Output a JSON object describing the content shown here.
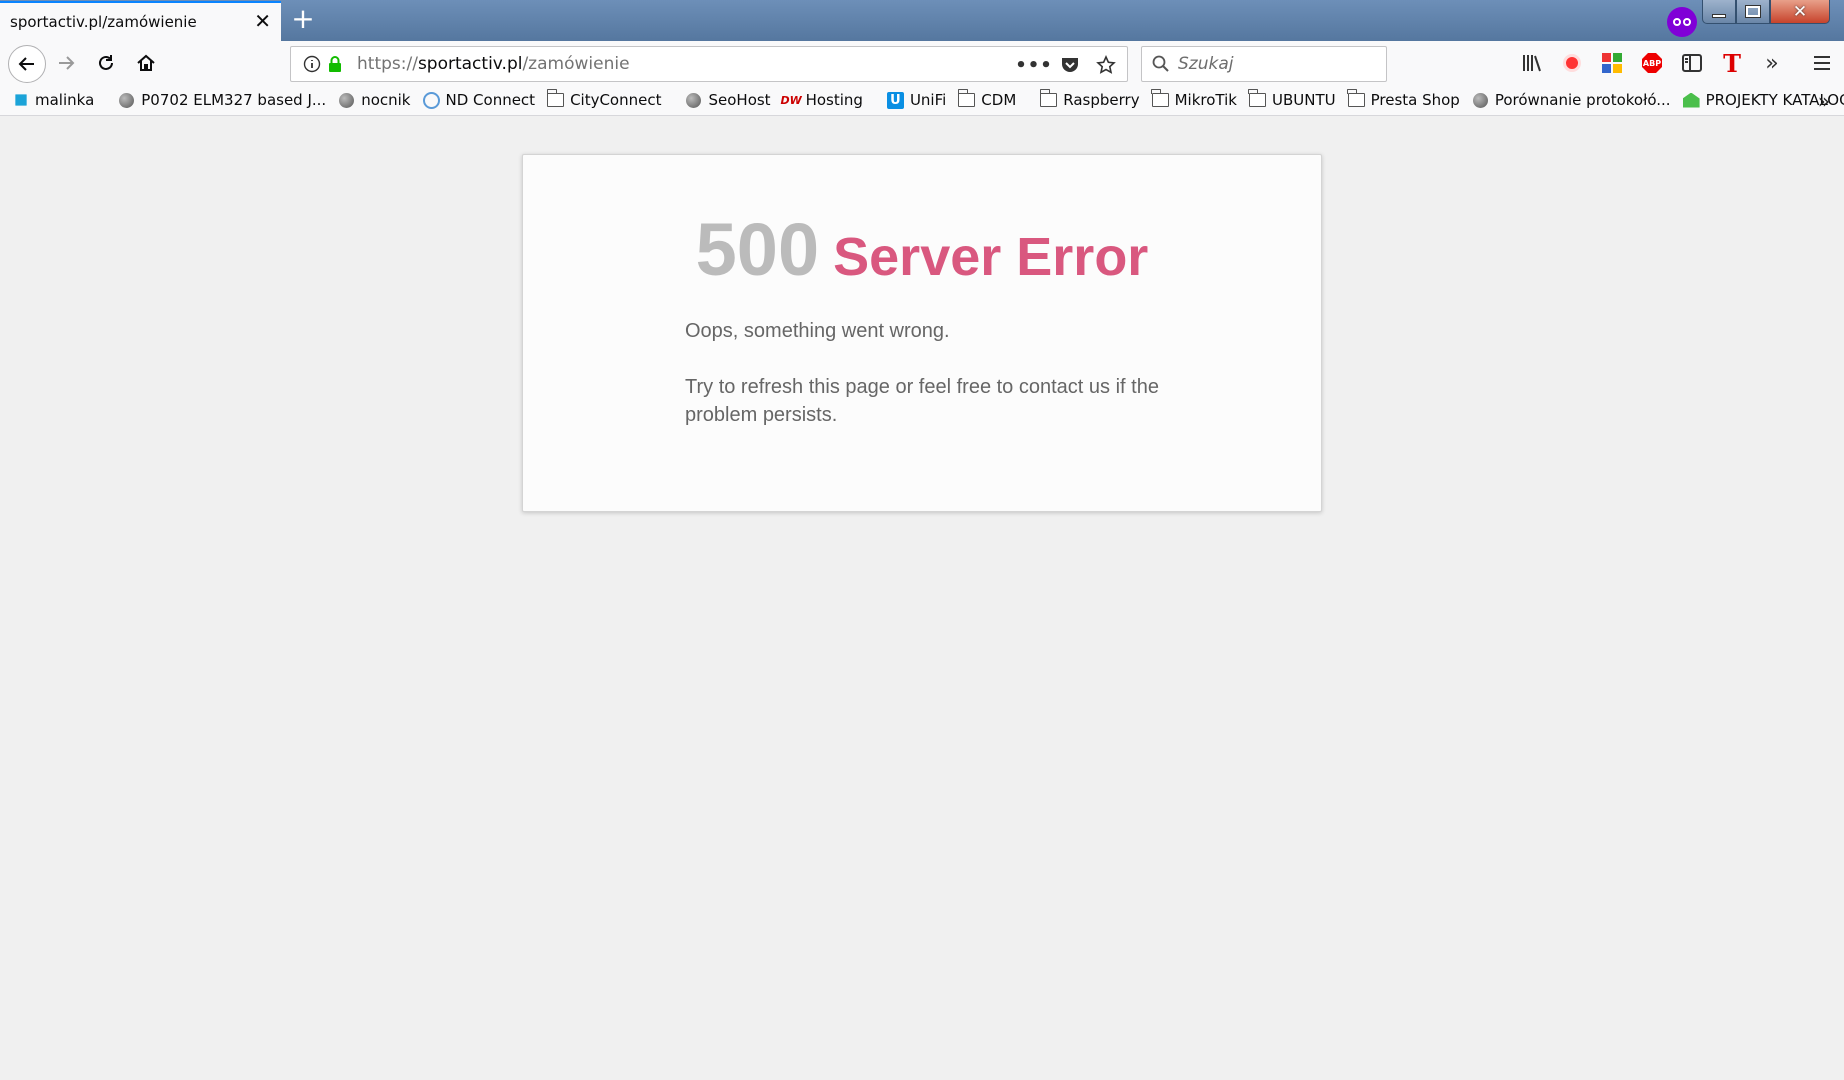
{
  "browser": {
    "tab": {
      "title": "sportactiv.pl/zamówienie"
    },
    "new_tab_label": "+",
    "address": {
      "protocol": "https://",
      "domain": "sportactiv.pl",
      "path": "/zamówienie"
    },
    "search": {
      "placeholder": "Szukaj"
    },
    "bookmarks": [
      {
        "label": "malinka",
        "icon": "kodi-icon"
      },
      {
        "label": "P0702 ELM327 based J...",
        "icon": "globe-icon"
      },
      {
        "label": "nocnik",
        "icon": "globe-icon"
      },
      {
        "label": "ND Connect",
        "icon": "nd-icon"
      },
      {
        "label": "CityConnect",
        "icon": "folder-icon"
      },
      {
        "label": "SeoHost",
        "icon": "globe-icon"
      },
      {
        "label": "Hosting",
        "icon": "dw-icon",
        "icon_text": "DW"
      },
      {
        "label": "UniFi",
        "icon": "unifi-icon",
        "icon_text": "U"
      },
      {
        "label": "CDM",
        "icon": "folder-icon"
      },
      {
        "label": "Raspberry",
        "icon": "folder-icon"
      },
      {
        "label": "MikroTik",
        "icon": "folder-icon"
      },
      {
        "label": "UBUNTU",
        "icon": "folder-icon"
      },
      {
        "label": "Presta Shop",
        "icon": "folder-icon"
      },
      {
        "label": "Porównanie protokołó...",
        "icon": "globe-icon"
      },
      {
        "label": "PROJEKTY KATALOGO...",
        "icon": "house-icon"
      }
    ],
    "toolbar_icons": {
      "abp_text": "ABP",
      "t_text": "T"
    }
  },
  "error": {
    "code": "500",
    "title": "Server Error",
    "message": "Oops, something went wrong.",
    "detail": "Try to refresh this page or feel free to contact us if the problem persists."
  },
  "colors": {
    "error_code": "#bbbbbb",
    "error_title": "#d9587f",
    "text": "#666666",
    "tab_accent": "#0a84ff"
  }
}
